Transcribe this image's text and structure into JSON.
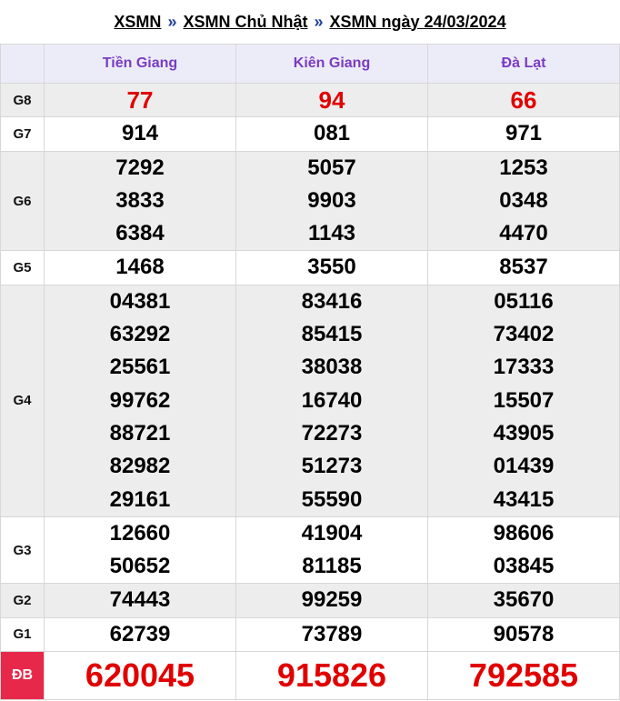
{
  "breadcrumb": {
    "link1": "XSMN",
    "link2": "XSMN Chủ Nhật",
    "link3": "XSMN ngày 24/03/2024",
    "separator": "»"
  },
  "provinces": [
    "Tiền Giang",
    "Kiên Giang",
    "Đà Lạt"
  ],
  "colors": {
    "header_bg": "#ececf9",
    "header_text": "#7a3cc2",
    "prize_red": "#e00000",
    "db_label_bg": "#e8284a",
    "alt_row_bg": "#ededed"
  },
  "prizes": [
    {
      "label": "G8",
      "values": [
        [
          "77"
        ],
        [
          "94"
        ],
        [
          "66"
        ]
      ]
    },
    {
      "label": "G7",
      "values": [
        [
          "914"
        ],
        [
          "081"
        ],
        [
          "971"
        ]
      ]
    },
    {
      "label": "G6",
      "values": [
        [
          "7292",
          "3833",
          "6384"
        ],
        [
          "5057",
          "9903",
          "1143"
        ],
        [
          "1253",
          "0348",
          "4470"
        ]
      ]
    },
    {
      "label": "G5",
      "values": [
        [
          "1468"
        ],
        [
          "3550"
        ],
        [
          "8537"
        ]
      ]
    },
    {
      "label": "G4",
      "values": [
        [
          "04381",
          "63292",
          "25561",
          "99762",
          "88721",
          "82982",
          "29161"
        ],
        [
          "83416",
          "85415",
          "38038",
          "16740",
          "72273",
          "51273",
          "55590"
        ],
        [
          "05116",
          "73402",
          "17333",
          "15507",
          "43905",
          "01439",
          "43415"
        ]
      ]
    },
    {
      "label": "G3",
      "values": [
        [
          "12660",
          "50652"
        ],
        [
          "41904",
          "81185"
        ],
        [
          "98606",
          "03845"
        ]
      ]
    },
    {
      "label": "G2",
      "values": [
        [
          "74443"
        ],
        [
          "99259"
        ],
        [
          "35670"
        ]
      ]
    },
    {
      "label": "G1",
      "values": [
        [
          "62739"
        ],
        [
          "73789"
        ],
        [
          "90578"
        ]
      ]
    },
    {
      "label": "ĐB",
      "values": [
        [
          "620045"
        ],
        [
          "915826"
        ],
        [
          "792585"
        ]
      ]
    }
  ]
}
